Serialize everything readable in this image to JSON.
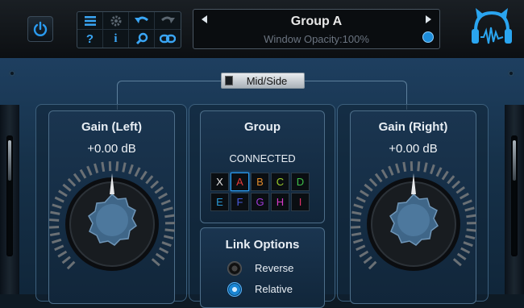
{
  "toolbar": {
    "icons": [
      "menu-icon",
      "gear-icon",
      "undo-icon",
      "redo-icon",
      "help-icon",
      "info-icon",
      "zoom-icon",
      "link-icon"
    ]
  },
  "preset": {
    "name": "Group A",
    "opacity_text": "Window Opacity:100%"
  },
  "midside": {
    "label": "Mid/Side"
  },
  "gain_left": {
    "title": "Gain (Left)",
    "value": "+0.00 dB"
  },
  "gain_right": {
    "title": "Gain (Right)",
    "value": "+0.00 dB"
  },
  "group": {
    "title": "Group",
    "status": "CONNECTED",
    "buttons": [
      {
        "label": "X",
        "color": "#e6e6e6"
      },
      {
        "label": "A",
        "color": "#e53a3a"
      },
      {
        "label": "B",
        "color": "#e08a2a"
      },
      {
        "label": "C",
        "color": "#9ccf2a"
      },
      {
        "label": "D",
        "color": "#3fbf4a"
      },
      {
        "label": "E",
        "color": "#2a9bd8"
      },
      {
        "label": "F",
        "color": "#4a5de0"
      },
      {
        "label": "G",
        "color": "#a03ad8"
      },
      {
        "label": "H",
        "color": "#d83ac8"
      },
      {
        "label": "I",
        "color": "#e0306a"
      }
    ]
  },
  "link_options": {
    "title": "Link Options",
    "reverse_label": "Reverse",
    "relative_label": "Relative"
  },
  "colors": {
    "accent": "#1d8cd8",
    "panel": "#163149"
  }
}
